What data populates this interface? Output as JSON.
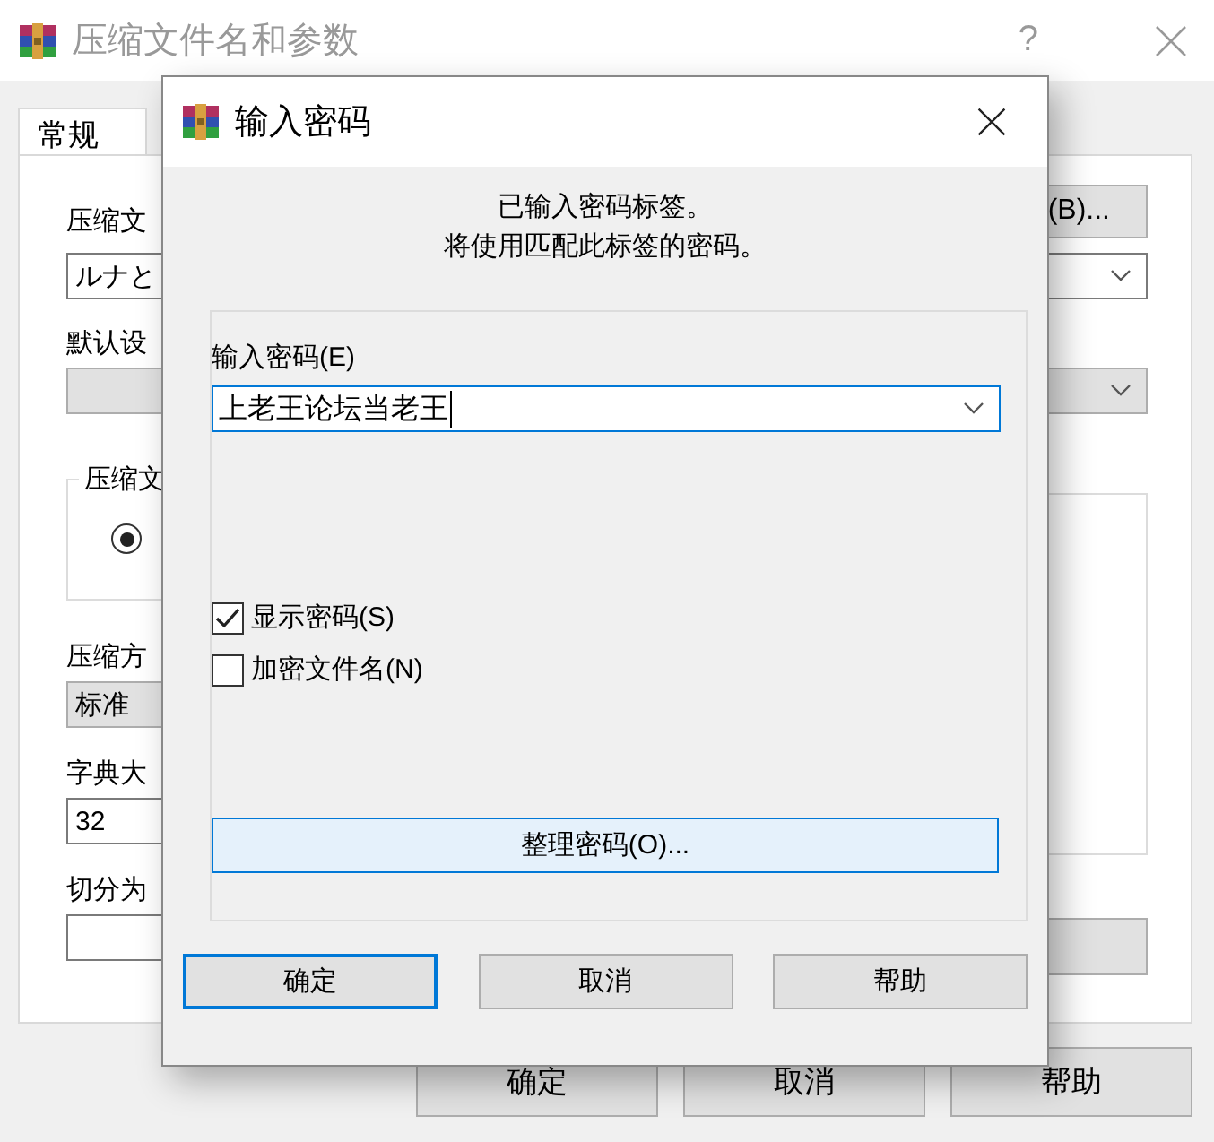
{
  "background_window": {
    "title": "压缩文件名和参数",
    "help_button": "?",
    "tabs": [
      {
        "label": "常规",
        "selected": true
      }
    ],
    "archive_name_label": "压缩文",
    "browse_button": "(B)...",
    "archive_name_value": "ルナと",
    "profiles_label": "默认设",
    "format_group_label": "压缩文",
    "format_radio": {
      "selected": true
    },
    "method_label": "压缩方",
    "method_value": "标准",
    "dictionary_label": "字典大",
    "dictionary_value": "32",
    "split_label": "切分为",
    "buttons": [
      "确定",
      "取消",
      "帮助"
    ]
  },
  "dialog": {
    "title": "输入密码",
    "message": [
      "已输入密码标签。",
      "将使用匹配此标签的密码。"
    ],
    "password_label": "输入密码(E)",
    "password_value": "上老王论坛当老王",
    "options": [
      {
        "label": "显示密码(S)",
        "checked": true
      },
      {
        "label": "加密文件名(N)",
        "checked": false
      }
    ],
    "organize_button": "整理密码(O)...",
    "buttons": [
      {
        "label": "确定",
        "default": true
      },
      {
        "label": "取消",
        "default": false
      },
      {
        "label": "帮助",
        "default": false
      }
    ]
  }
}
